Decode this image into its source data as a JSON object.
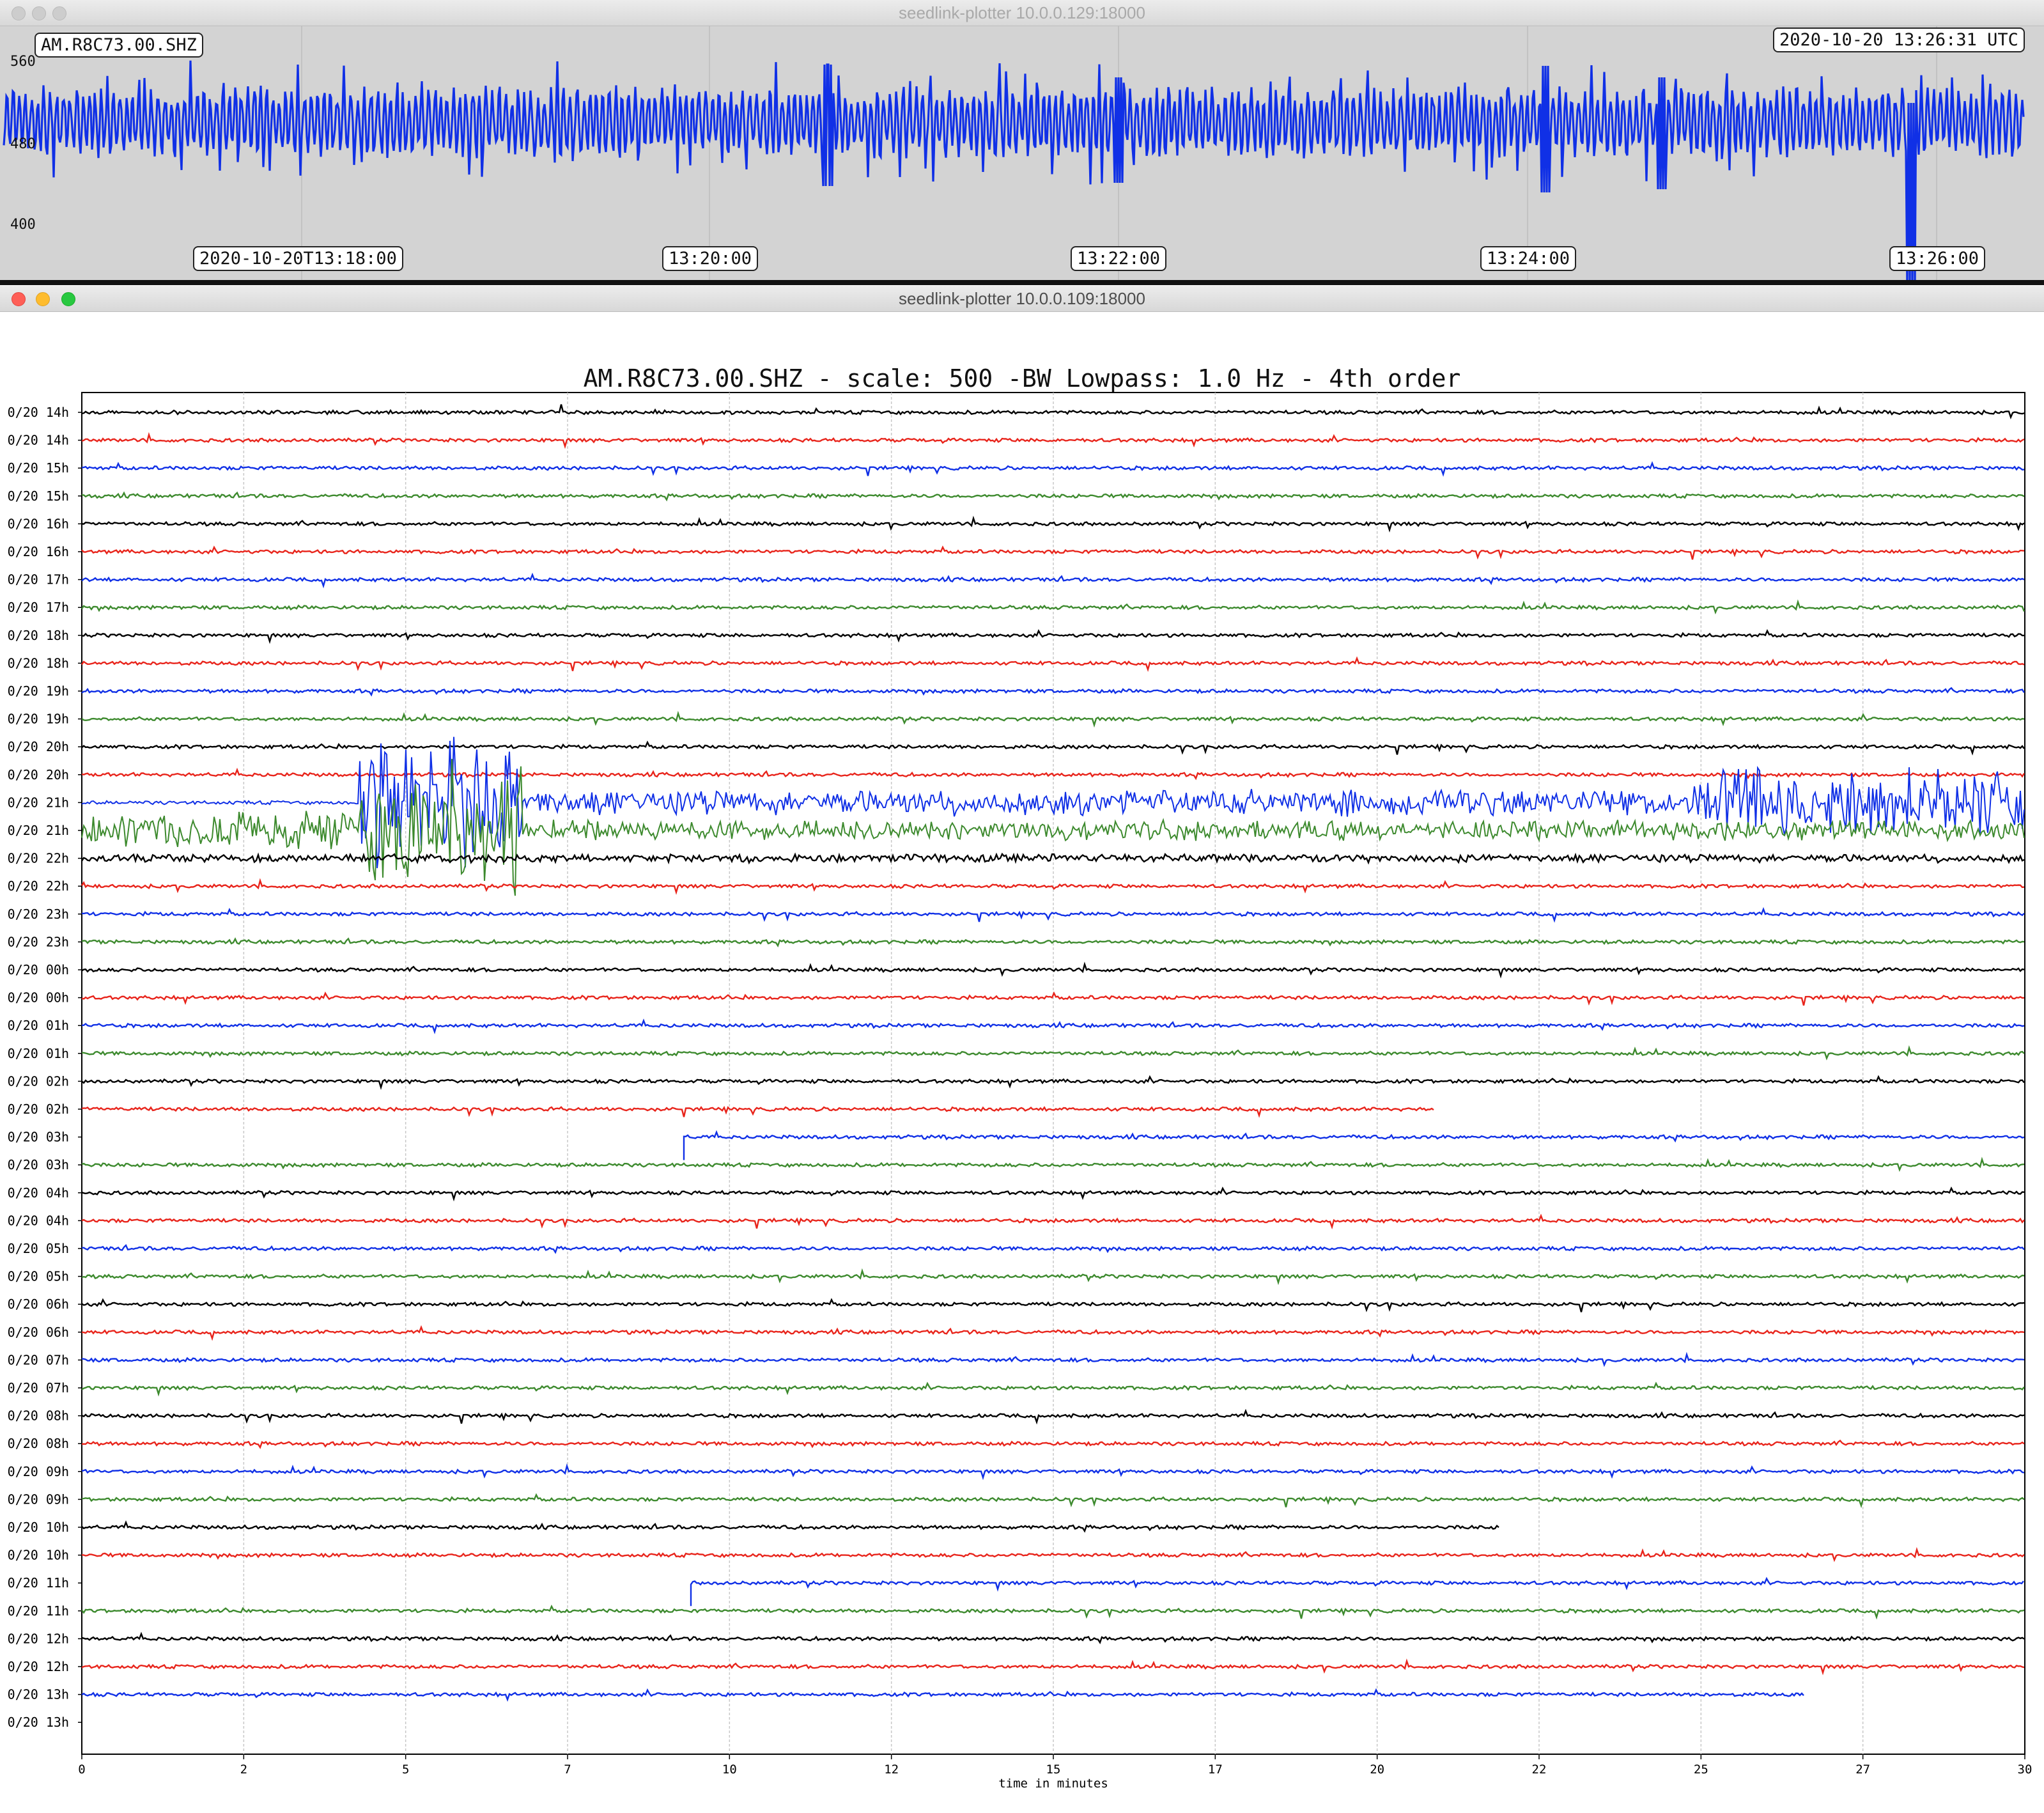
{
  "windows": {
    "top": {
      "title": "seedlink-plotter 10.0.0.129:18000",
      "active": false
    },
    "bottom": {
      "title": "seedlink-plotter 10.0.0.109:18000",
      "active": true
    }
  },
  "strip": {
    "station_label": "AM.R8C73.00.SHZ",
    "timestamp_label": "2020-10-20 13:26:31 UTC",
    "y_ticks": [
      "560",
      "480",
      "400"
    ],
    "time_ticks": [
      "2020-10-20T13:18:00",
      "13:20:00",
      "13:22:00",
      "13:24:00",
      "13:26:00"
    ],
    "trace_color": "#1030e6"
  },
  "helicorder": {
    "title": "AM.R8C73.00.SHZ - scale: 500 -BW Lowpass: 1.0 Hz - 4th order",
    "row_labels": [
      "0/20 14h",
      "0/20 14h",
      "0/20 15h",
      "0/20 15h",
      "0/20 16h",
      "0/20 16h",
      "0/20 17h",
      "0/20 17h",
      "0/20 18h",
      "0/20 18h",
      "0/20 19h",
      "0/20 19h",
      "0/20 20h",
      "0/20 20h",
      "0/20 21h",
      "0/20 21h",
      "0/20 22h",
      "0/20 22h",
      "0/20 23h",
      "0/20 23h",
      "0/20 00h",
      "0/20 00h",
      "0/20 01h",
      "0/20 01h",
      "0/20 02h",
      "0/20 02h",
      "0/20 03h",
      "0/20 03h",
      "0/20 04h",
      "0/20 04h",
      "0/20 05h",
      "0/20 05h",
      "0/20 06h",
      "0/20 06h",
      "0/20 07h",
      "0/20 07h",
      "0/20 08h",
      "0/20 08h",
      "0/20 09h",
      "0/20 09h",
      "0/20 10h",
      "0/20 10h",
      "0/20 11h",
      "0/20 11h",
      "0/20 12h",
      "0/20 12h",
      "0/20 13h",
      "0/20 13h"
    ],
    "x_ticks": [
      "0",
      "2",
      "5",
      "7",
      "10",
      "12",
      "15",
      "17",
      "20",
      "22",
      "25",
      "27",
      "30"
    ],
    "xlabel": "time in minutes",
    "row_colors": [
      "#000000",
      "#e8241b",
      "#1030e6",
      "#3d8a2e"
    ]
  },
  "chart_data": [
    {
      "type": "line",
      "title": "AM.R8C73.00.SHZ",
      "xlabel": "",
      "ylabel": "",
      "x_ticks": [
        "2020-10-20T13:18:00",
        "13:20:00",
        "13:22:00",
        "13:24:00",
        "13:26:00"
      ],
      "y_ticks": [
        560,
        480,
        400
      ],
      "series": [
        {
          "values": []
        }
      ]
    },
    {
      "type": "line",
      "title": "AM.R8C73.00.SHZ - scale: 500 -BW Lowpass: 1.0 Hz - 4th order",
      "xlabel": "time in minutes",
      "xlim": [
        0,
        30
      ],
      "x_ticks": [
        0,
        2,
        5,
        7,
        10,
        12,
        15,
        17,
        20,
        22,
        25,
        27,
        30
      ],
      "grid": true,
      "rows": 48,
      "events": [
        {
          "row": 14,
          "start_minute": 4.2,
          "end_minute": 30,
          "description": ""
        }
      ],
      "row_end_minutes": {
        "25": 20.9,
        "46": 26.6,
        "40": 21.9
      },
      "row_start_minutes": {
        "26": 9.3,
        "42": 9.4
      }
    }
  ]
}
